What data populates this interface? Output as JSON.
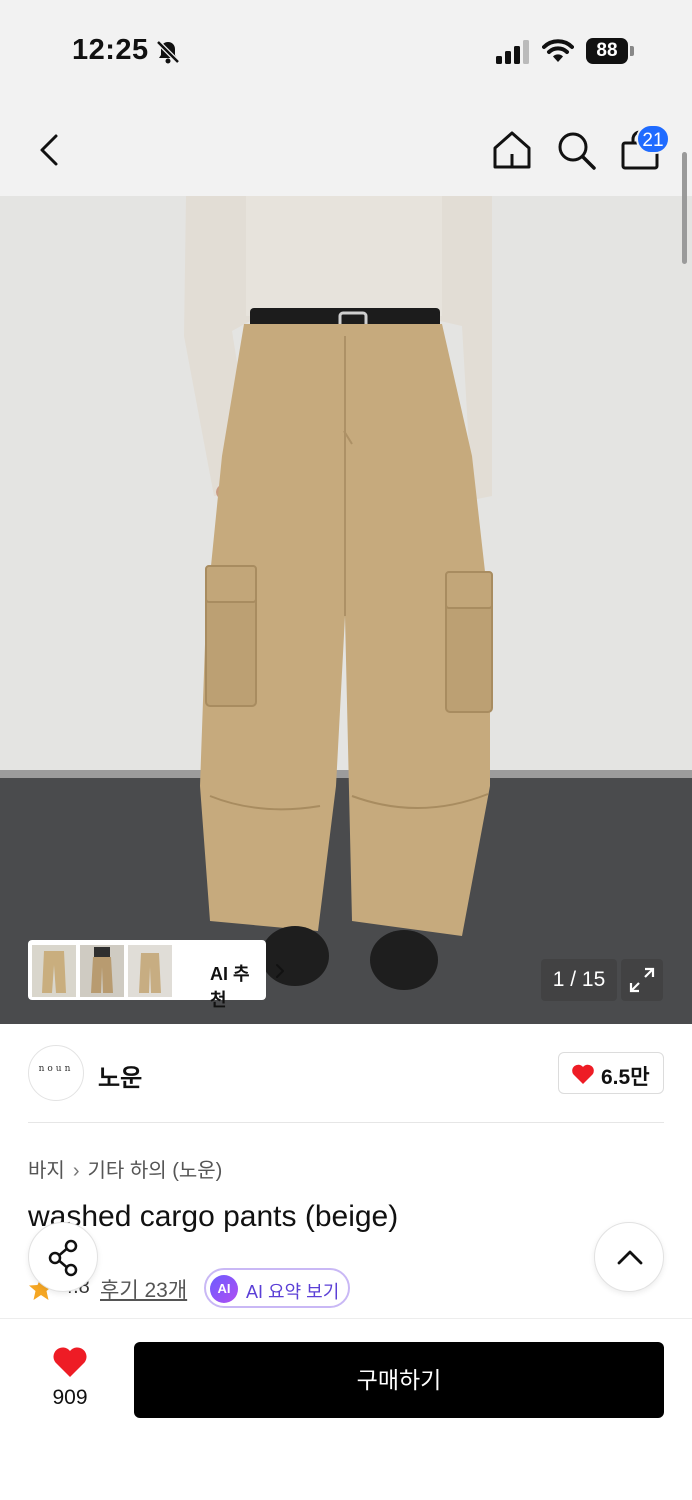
{
  "status_bar": {
    "time": "12:25",
    "battery": "88",
    "icons": [
      "bell-off-icon",
      "signal-icon",
      "wifi-icon",
      "battery-icon"
    ]
  },
  "nav": {
    "icons": [
      "back-icon",
      "home-icon",
      "search-icon",
      "cart-icon"
    ],
    "cart_count": "21"
  },
  "gallery": {
    "ai_recommend_label": "AI 추천",
    "page_counter": "1 / 15",
    "icons": [
      "expand-icon",
      "chevron-right-icon"
    ]
  },
  "brand": {
    "logo_text": "noun",
    "name": "노운",
    "like_count": "6.5만"
  },
  "product": {
    "breadcrumb": [
      "바지",
      "기타 하의 (노운)"
    ],
    "title": "washed cargo pants (beige)",
    "rating": "4.8",
    "review_link": "후기 23개",
    "ai_badge": "AI",
    "ai_summary_label": "AI 요약 보기"
  },
  "bottom_bar": {
    "wish_count": "909",
    "buy_label": "구매하기"
  },
  "colors": {
    "accent_blue": "#1f6bff",
    "heart_red": "#ee1c25",
    "buy_button": "#000000",
    "ai_purple": "#6c5cff",
    "star_yellow": "#f5a623"
  }
}
